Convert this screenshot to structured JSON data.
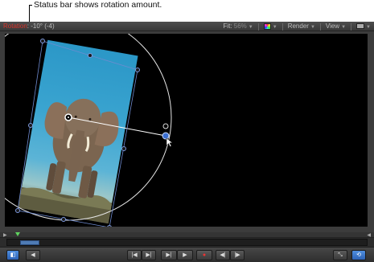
{
  "callout": {
    "text": "Status bar shows rotation amount."
  },
  "statusbar": {
    "label": "Rotation",
    "value": ": -10° (-4)",
    "fit_label": "Fit:",
    "fit_value": "56%",
    "render_label": "Render",
    "view_label": "View"
  },
  "colors": {
    "accent": "#2d63b6",
    "status_label": "#d9342b",
    "playhead": "#5fd35f",
    "guide": "#ffffff"
  },
  "canvas": {
    "rotation_degrees": -10
  },
  "icons": [
    "color-channels-icon",
    "layout-icon",
    "zoom-to-fit-icon",
    "loop-icon",
    "play-icon",
    "record-icon"
  ]
}
